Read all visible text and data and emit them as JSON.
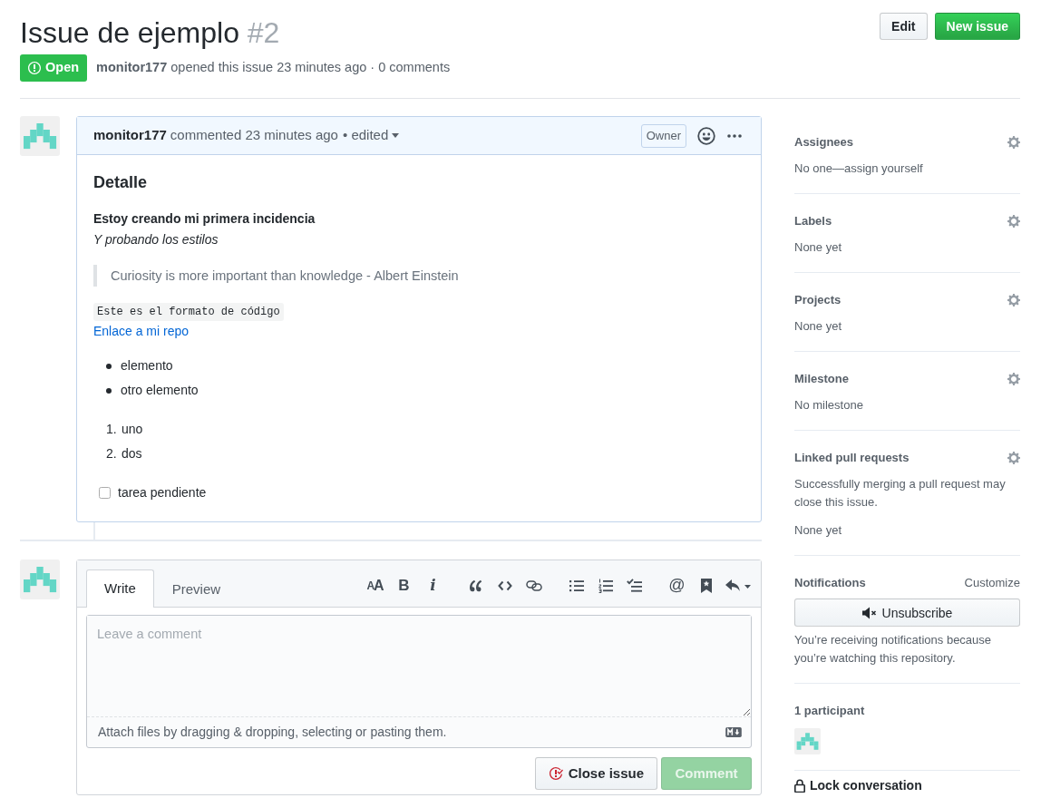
{
  "header": {
    "title": "Issue de ejemplo",
    "number": "#2",
    "buttons": [
      {
        "label": "Edit",
        "kind": "secondary"
      },
      {
        "label": "New issue",
        "kind": "primary"
      }
    ]
  },
  "state": {
    "kind": "open",
    "label": "Open"
  },
  "summary": {
    "author": "monitor177",
    "text": "opened this issue 23 minutes ago · 0 comments"
  },
  "comment": {
    "author": "monitor177",
    "action": "commented 23 minutes ago",
    "edited": "• edited",
    "role": "Owner",
    "body": [
      {
        "kind": "heading",
        "text": "Detalle"
      },
      {
        "kind": "strong",
        "text": "Estoy creando mi primera incidencia"
      },
      {
        "kind": "emphasis",
        "text": "Y probando los estilos"
      },
      {
        "kind": "quote",
        "text": "Curiosity is more important than knowledge - Albert Einstein"
      },
      {
        "kind": "code",
        "text": "Este es el formato de código"
      },
      {
        "kind": "link",
        "text": "Enlace a mi repo"
      },
      {
        "kind": "bullets",
        "items": [
          "elemento",
          "otro elemento"
        ]
      },
      {
        "kind": "numbered",
        "items": [
          {
            "number": "1.",
            "text": "uno"
          },
          {
            "number": "2.",
            "text": "dos"
          }
        ]
      },
      {
        "kind": "task",
        "text": "tarea pendiente",
        "checked": false
      }
    ]
  },
  "reply": {
    "tabs": [
      {
        "label": "Write",
        "selected": true
      },
      {
        "label": "Preview",
        "selected": false
      }
    ],
    "toolbar": [
      [
        {
          "kind": "size",
          "text": "AA"
        },
        {
          "kind": "bold",
          "text": "B"
        },
        {
          "kind": "italic",
          "text": "i"
        }
      ],
      [
        {
          "kind": "quote"
        },
        {
          "kind": "code"
        },
        {
          "kind": "link"
        }
      ],
      [
        {
          "kind": "bullets"
        },
        {
          "kind": "numbers"
        },
        {
          "kind": "tasks"
        }
      ],
      [
        {
          "kind": "mention",
          "text": "@"
        },
        {
          "kind": "bookmark"
        },
        {
          "kind": "reply"
        }
      ]
    ],
    "placeholder": "Leave a comment",
    "attach_hint": "Attach files by dragging & dropping, selecting or pasting them.",
    "buttons": [
      {
        "label": "Close issue",
        "kind": "close",
        "disabled": false
      },
      {
        "label": "Comment",
        "kind": "submit",
        "disabled": true
      }
    ]
  },
  "sidebar": [
    {
      "kind": "field",
      "heading": "Assignees",
      "lines": [
        "No one—assign yourself"
      ]
    },
    {
      "kind": "field",
      "heading": "Labels",
      "lines": [
        "None yet"
      ]
    },
    {
      "kind": "field",
      "heading": "Projects",
      "lines": [
        "None yet"
      ]
    },
    {
      "kind": "field",
      "heading": "Milestone",
      "lines": [
        "No milestone"
      ]
    },
    {
      "kind": "field",
      "heading": "Linked pull requests",
      "lines": [
        "Successfully merging a pull request may close this issue.",
        "None yet"
      ]
    },
    {
      "kind": "notifications",
      "heading": "Notifications",
      "action": "Customize",
      "button": "Unsubscribe",
      "lines": [
        "You’re receiving notifications because you’re watching this repository."
      ]
    },
    {
      "kind": "participants",
      "heading": "1 participant"
    },
    {
      "kind": "action",
      "label": "Lock conversation"
    }
  ]
}
